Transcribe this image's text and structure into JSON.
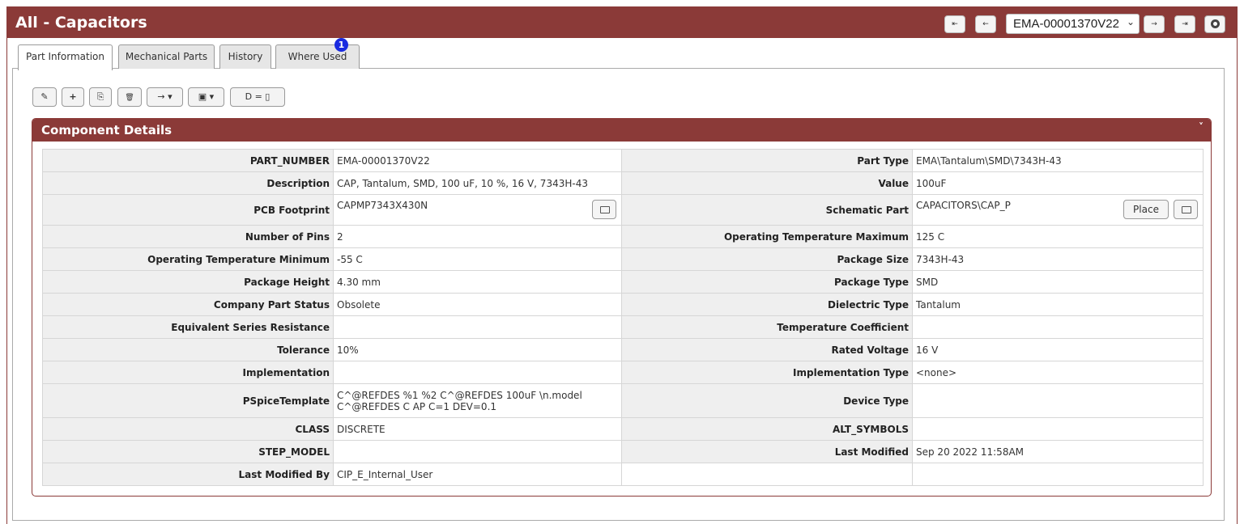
{
  "window": {
    "title": "All - Capacitors"
  },
  "nav": {
    "first_icon": "⇤",
    "prev_icon": "←",
    "next_icon": "→",
    "last_icon": "⇥",
    "selected_part": "EMA-00001370V22"
  },
  "tabs": [
    {
      "label": "Part Information"
    },
    {
      "label": "Mechanical Parts"
    },
    {
      "label": "History"
    },
    {
      "label": "Where Used"
    }
  ],
  "where_used_count": "1",
  "toolbar": {
    "edit_icon": "✎",
    "add_icon": "+",
    "copy_icon": "⎘",
    "delete_icon": "🗑",
    "move_icon": "→ ▾",
    "save_icon": "▣ ▾",
    "compare_icon": "D = ▯"
  },
  "section": {
    "title": "Component Details",
    "collapse_icon": "˅"
  },
  "details": {
    "part_number_label": "PART_NUMBER",
    "part_number": "EMA-00001370V22",
    "part_type_label": "Part Type",
    "part_type": "EMA\\Tantalum\\SMD\\7343H-43",
    "description_label": "Description",
    "description": "CAP, Tantalum, SMD, 100 uF, 10 %, 16 V, 7343H-43",
    "value_label": "Value",
    "value": "100uF",
    "pcb_footprint_label": "PCB Footprint",
    "pcb_footprint": "CAPMP7343X430N",
    "schematic_part_label": "Schematic Part",
    "schematic_part": "CAPACITORS\\CAP_P",
    "place_label": "Place",
    "number_of_pins_label": "Number of Pins",
    "number_of_pins": "2",
    "op_temp_max_label": "Operating Temperature Maximum",
    "op_temp_max": "125 C",
    "op_temp_min_label": "Operating Temperature Minimum",
    "op_temp_min": "-55 C",
    "package_size_label": "Package Size",
    "package_size": "7343H-43",
    "package_height_label": "Package Height",
    "package_height": "4.30 mm",
    "package_type_label": "Package Type",
    "package_type": "SMD",
    "company_status_label": "Company Part Status",
    "company_status": "Obsolete",
    "dielectric_label": "Dielectric Type",
    "dielectric": "Tantalum",
    "esr_label": "Equivalent Series Resistance",
    "esr": "",
    "temp_coeff_label": "Temperature Coefficient",
    "temp_coeff": "",
    "tolerance_label": "Tolerance",
    "tolerance": "10%",
    "rated_voltage_label": "Rated Voltage",
    "rated_voltage": "16 V",
    "implementation_label": "Implementation",
    "implementation": "",
    "implementation_type_label": "Implementation Type",
    "implementation_type": "<none>",
    "pspice_label": "PSpiceTemplate",
    "pspice": "C^@REFDES %1 %2 C^@REFDES 100uF \\n.model C^@REFDES C AP C=1 DEV=0.1",
    "device_type_label": "Device Type",
    "device_type": "",
    "class_label": "CLASS",
    "class": "DISCRETE",
    "alt_symbols_label": "ALT_SYMBOLS",
    "alt_symbols": "",
    "step_model_label": "STEP_MODEL",
    "step_model": "",
    "last_modified_label": "Last Modified",
    "last_modified": "Sep 20 2022 11:58AM",
    "last_modified_by_label": "Last Modified By",
    "last_modified_by": "CIP_E_Internal_User"
  },
  "colors": {
    "header": "#8b3a38",
    "badge": "#1a2be0",
    "label_bg": "#efefef"
  }
}
